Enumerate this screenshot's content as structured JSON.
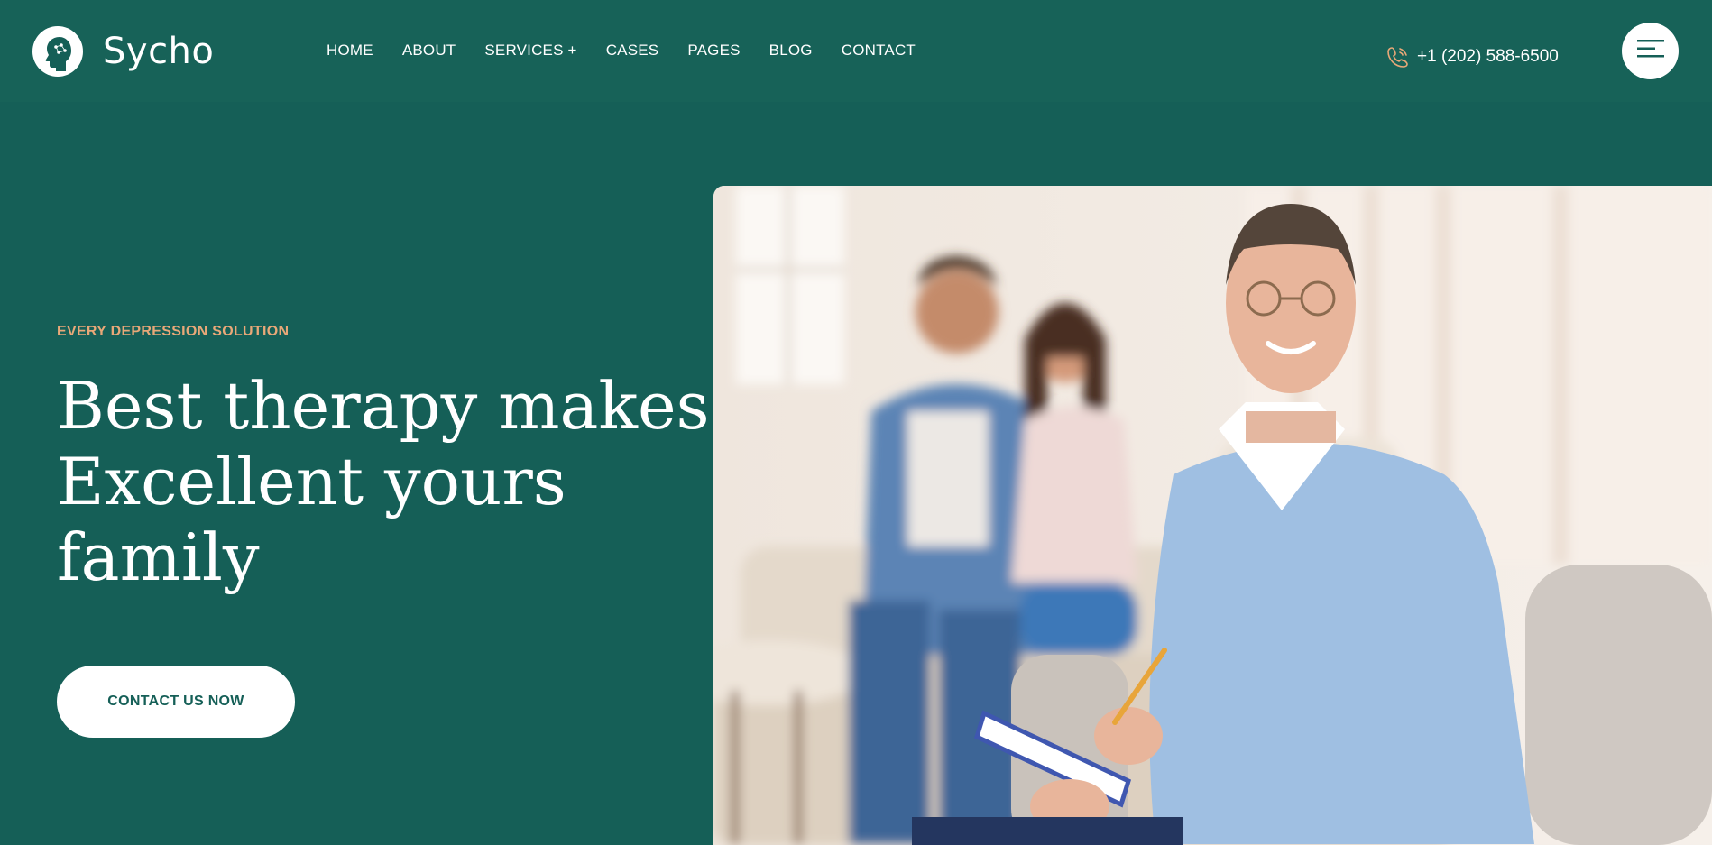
{
  "brand": {
    "name": "Sycho"
  },
  "nav": {
    "items": [
      {
        "label": "HOME"
      },
      {
        "label": "ABOUT"
      },
      {
        "label": "SERVICES +"
      },
      {
        "label": "CASES"
      },
      {
        "label": "PAGES"
      },
      {
        "label": "BLOG"
      },
      {
        "label": "CONTACT"
      }
    ]
  },
  "header": {
    "phone": "+1 (202) 588-6500"
  },
  "hero": {
    "eyebrow": "EVERY DEPRESSION SOLUTION",
    "title_lines": [
      "Best therapy makes",
      "Excellent yours",
      "family"
    ],
    "cta_label": "CONTACT US NOW"
  },
  "colors": {
    "background": "#155f57",
    "header": "#176258",
    "accent": "#e9a878",
    "white": "#ffffff"
  },
  "icons": {
    "logo": "head-brain-icon",
    "phone": "phone-call-icon",
    "menu": "hamburger-menu-icon"
  }
}
